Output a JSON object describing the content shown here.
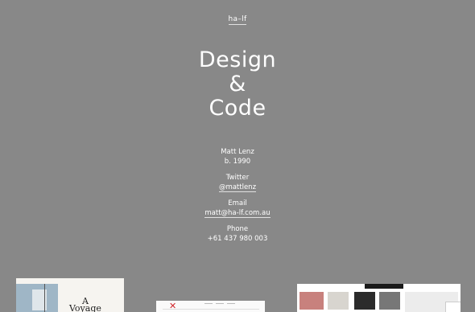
{
  "site": {
    "logo": "ha–lf"
  },
  "headline": {
    "line1": "Design",
    "line2": "&",
    "line3": "Code"
  },
  "profile": {
    "name": "Matt Lenz",
    "born": "b. 1990",
    "twitter_label": "Twitter",
    "twitter_handle": "@mattlenz",
    "email_label": "Email",
    "email_value": "matt@ha-lf.com.au",
    "phone_label": "Phone",
    "phone_value": "+61 437 980 003"
  },
  "projects": [
    {
      "name": "voyage",
      "title_line1": "A",
      "title_line2": "Voyage"
    },
    {
      "name": "pinboard"
    },
    {
      "name": "shop"
    }
  ],
  "colors": {
    "background": "#888888",
    "text": "#ffffff",
    "accent_red": "#d0262b"
  }
}
